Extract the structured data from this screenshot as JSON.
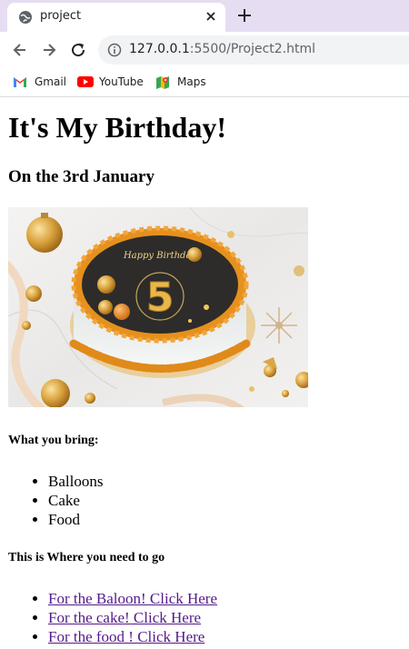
{
  "browser": {
    "tab": {
      "title": "project",
      "icon": "globe-icon"
    },
    "url": {
      "host": "127.0.0.1",
      "rest": ":5500/Project2.html"
    },
    "bookmarks": [
      {
        "label": "Gmail",
        "icon": "gmail-icon"
      },
      {
        "label": "YouTube",
        "icon": "youtube-icon"
      },
      {
        "label": "Maps",
        "icon": "maps-icon"
      }
    ],
    "colors": {
      "tabstrip": "#e6ddf3",
      "link": "#551a8b"
    }
  },
  "page": {
    "heading": "It's My Birthday!",
    "subheading": "On the 3rd January",
    "cake_topper_text": "Happy Birthday",
    "cake_number": "5",
    "bring_heading": "What you bring:",
    "bring_items": [
      "Balloons",
      "Cake",
      "Food"
    ],
    "where_heading": "This is Where you need to go",
    "links": [
      "For the Baloon! Click Here",
      "For the cake! Click Here",
      "For the food ! Click Here"
    ]
  }
}
